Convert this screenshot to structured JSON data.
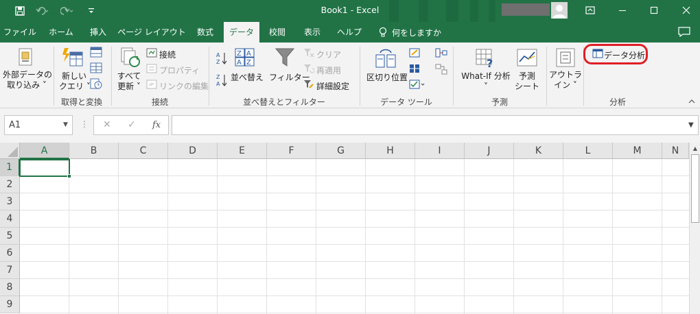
{
  "window": {
    "title": "Book1  -  Excel",
    "qat": {
      "save_icon": "save-icon",
      "undo_icon": "undo-icon",
      "redo_icon": "redo-icon",
      "customize_icon": "customize-qat-icon"
    },
    "controls": {
      "ribbon_display_icon": "ribbon-display-options-icon",
      "minimize_icon": "minimize-icon",
      "maximize_icon": "maximize-icon",
      "close_icon": "close-icon"
    }
  },
  "menu": {
    "tabs": [
      {
        "label": "ファイル",
        "active": false
      },
      {
        "label": "ホーム",
        "active": false
      },
      {
        "label": "挿入",
        "active": false
      },
      {
        "label": "ページ レイアウト",
        "active": false
      },
      {
        "label": "数式",
        "active": false
      },
      {
        "label": "データ",
        "active": true
      },
      {
        "label": "校閲",
        "active": false
      },
      {
        "label": "表示",
        "active": false
      },
      {
        "label": "ヘルプ",
        "active": false
      }
    ],
    "tell_me": "何をしますか"
  },
  "ribbon": {
    "get_transform": {
      "label": "取得と変換",
      "external_data": [
        "外部データの",
        "取り込み ˅"
      ],
      "new_query": [
        "新しい",
        "クエリ ˅"
      ]
    },
    "connections": {
      "label": "接続",
      "refresh_all": [
        "すべて",
        "更新 ˅"
      ],
      "connections_btn": "接続",
      "properties_btn": "プロパティ",
      "edit_links_btn": "リンクの編集"
    },
    "sort_filter": {
      "label": "並べ替えとフィルター",
      "sort_btn": "並べ替え",
      "filter_btn": "フィルター",
      "clear_btn": "クリア",
      "reapply_btn": "再適用",
      "advanced_btn": "詳細設定"
    },
    "data_tools": {
      "label": "データ ツール",
      "text_to_columns": "区切り位置"
    },
    "forecast": {
      "label": "予測",
      "whatif": [
        "What-If 分析",
        "˅"
      ],
      "forecast_sheet": [
        "予測",
        "シート"
      ]
    },
    "outline": {
      "btn": [
        "アウトラ",
        "イン ˅"
      ]
    },
    "analysis": {
      "label": "分析",
      "data_analysis": "データ分析",
      "highlight_color": "#e01e26"
    }
  },
  "formula_bar": {
    "name_box": "A1",
    "cancel_symbol": "✕",
    "enter_symbol": "✓",
    "fx_symbol": "fx",
    "formula": ""
  },
  "sheet": {
    "columns": [
      "A",
      "B",
      "C",
      "D",
      "E",
      "F",
      "G",
      "H",
      "I",
      "J",
      "K",
      "L",
      "M",
      "N"
    ],
    "rows": [
      "1",
      "2",
      "3",
      "4",
      "5",
      "6",
      "7",
      "8",
      "9"
    ],
    "active_cell": "A1"
  },
  "colors": {
    "excel_green": "#217346",
    "ribbon_bg": "#f3f3f3"
  }
}
